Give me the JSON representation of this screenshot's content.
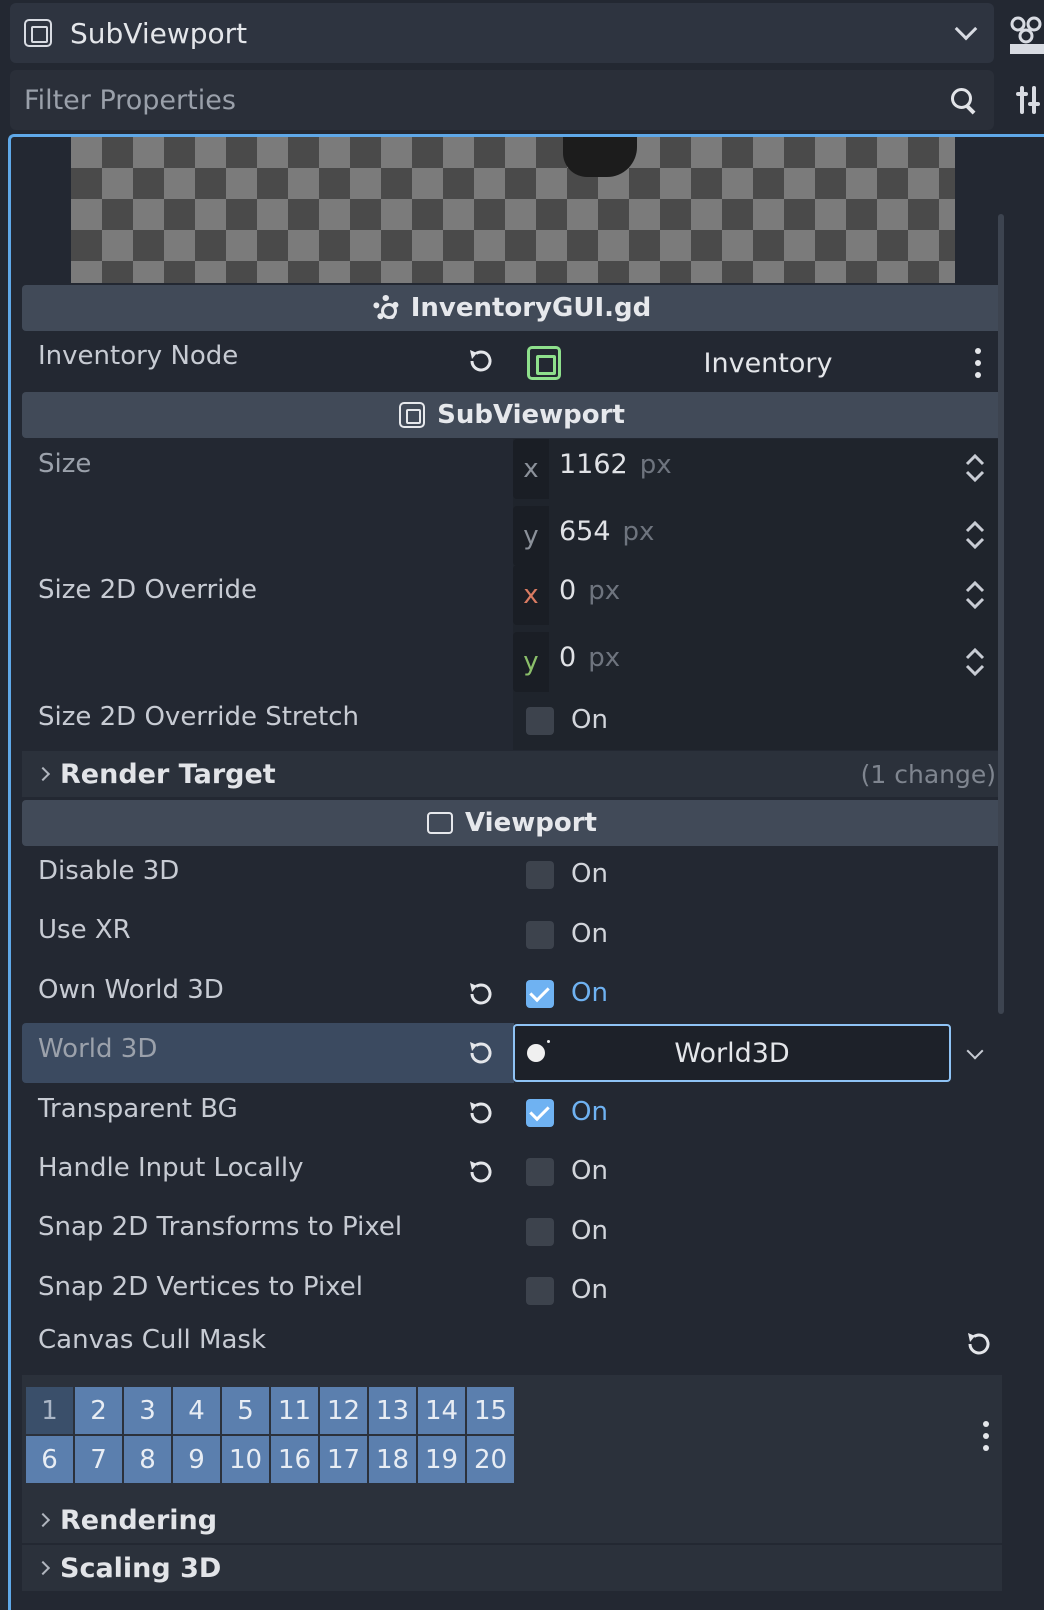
{
  "header": {
    "node_name": "SubViewport"
  },
  "filter": {
    "placeholder": "Filter Properties"
  },
  "sections": {
    "script": "InventoryGUI.gd",
    "subviewport": "SubViewport",
    "viewport": "Viewport"
  },
  "inventory_node": {
    "label": "Inventory Node",
    "value": "Inventory"
  },
  "size": {
    "label": "Size",
    "x_axis": "x",
    "x_value": "1162",
    "y_axis": "y",
    "y_value": "654",
    "unit": "px"
  },
  "size_2d_override": {
    "label": "Size 2D Override",
    "x_axis": "x",
    "x_value": "0",
    "y_axis": "y",
    "y_value": "0",
    "unit": "px"
  },
  "size_2d_override_stretch": {
    "label": "Size 2D Override Stretch",
    "value": "On",
    "checked": false
  },
  "render_target": {
    "label": "Render Target",
    "change_note": "(1 change)"
  },
  "viewport_props": [
    {
      "label": "Disable 3D",
      "value": "On",
      "checked": false,
      "revert": false
    },
    {
      "label": "Use XR",
      "value": "On",
      "checked": false,
      "revert": false
    },
    {
      "label": "Own World 3D",
      "value": "On",
      "checked": true,
      "revert": true
    }
  ],
  "world_3d": {
    "label": "World 3D",
    "value": "World3D"
  },
  "viewport_props_2": [
    {
      "label": "Transparent BG",
      "value": "On",
      "checked": true,
      "revert": true
    },
    {
      "label": "Handle Input Locally",
      "value": "On",
      "checked": false,
      "revert": true
    },
    {
      "label": "Snap 2D Transforms to Pixel",
      "value": "On",
      "checked": false,
      "revert": false
    },
    {
      "label": "Snap 2D Vertices to Pixel",
      "value": "On",
      "checked": false,
      "revert": false
    }
  ],
  "canvas_cull_mask": {
    "label": "Canvas Cull Mask",
    "row1": [
      "1",
      "2",
      "3",
      "4",
      "5",
      "11",
      "12",
      "13",
      "14",
      "15"
    ],
    "row2": [
      "6",
      "7",
      "8",
      "9",
      "10",
      "16",
      "17",
      "18",
      "19",
      "20"
    ]
  },
  "collapsed": {
    "rendering": "Rendering",
    "scaling_3d": "Scaling 3D"
  },
  "colors": {
    "accent": "#6fb2f2",
    "node_green": "#8ee08c",
    "layer_on": "#5b7fae"
  }
}
